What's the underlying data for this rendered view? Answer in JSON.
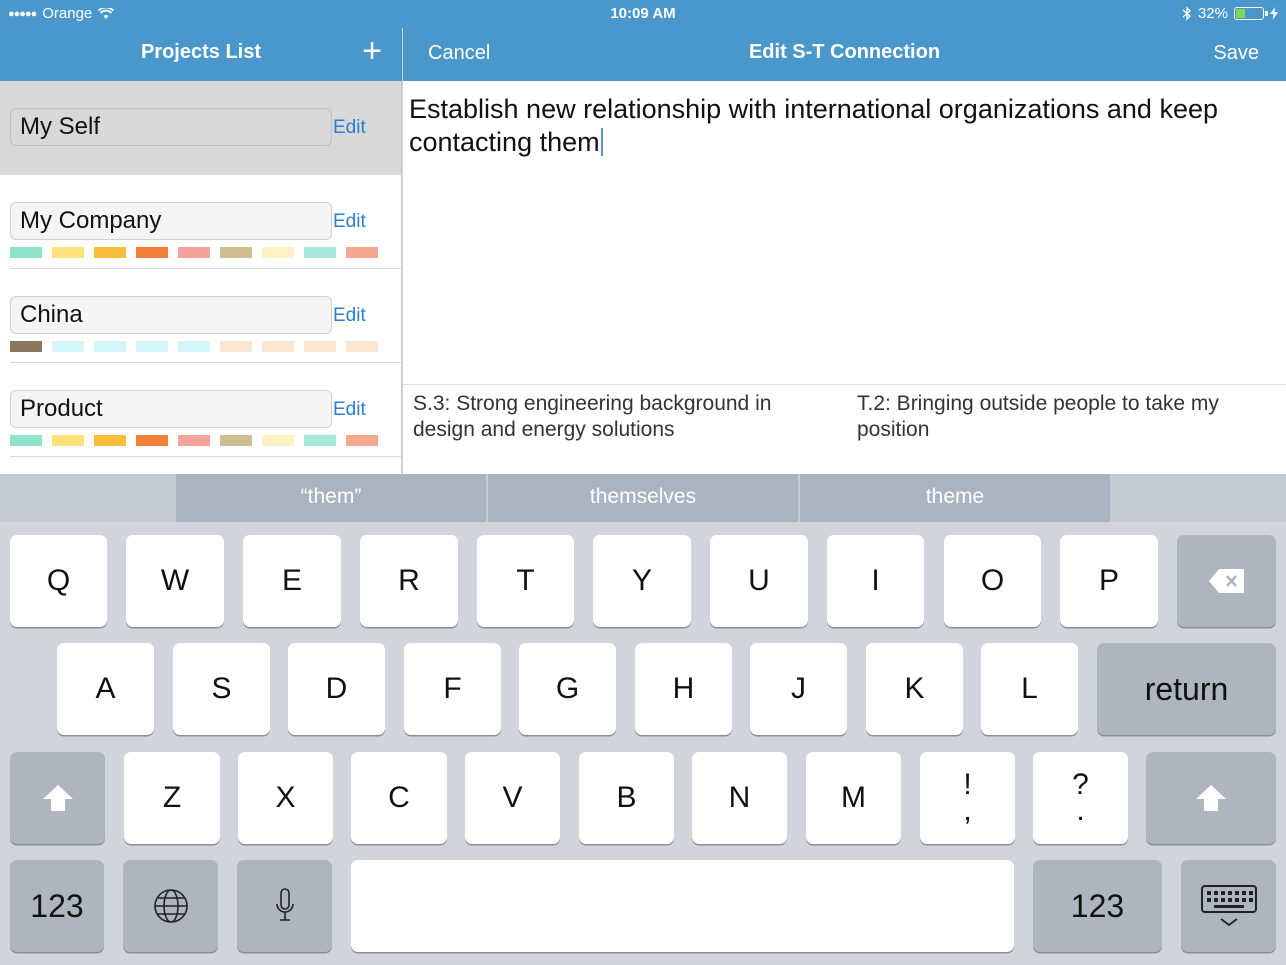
{
  "status_bar": {
    "signal": "●●●●●",
    "carrier": "Orange",
    "time": "10:09 AM",
    "battery": "32%",
    "battery_level": 0.32
  },
  "left_pane": {
    "title": "Projects List",
    "add_glyph": "+",
    "projects": [
      {
        "name": "My Self",
        "edit": "Edit",
        "selected": true,
        "swatches": []
      },
      {
        "name": "My Company",
        "edit": "Edit",
        "swatches": [
          "#8fe3c9",
          "#fbe27a",
          "#f7bd3b",
          "#f5803c",
          "#f6a49a",
          "#cdbf92",
          "#fdf2c4",
          "#a8e8d9",
          "#f6a78f"
        ]
      },
      {
        "name": "China",
        "edit": "Edit",
        "swatches": [
          "#8a7560",
          "#d4f6fb",
          "#d4f6fb",
          "#d4f6fb",
          "#d4f6fb",
          "#fbe6d3",
          "#fbe6d3",
          "#fbe6d3",
          "#fbe6d3"
        ]
      },
      {
        "name": "Product",
        "edit": "Edit",
        "swatches": [
          "#8fe3c9",
          "#fbe27a",
          "#f7bd3b",
          "#f5803c",
          "#f6a49a",
          "#cdbf92",
          "#fdf2c4",
          "#a8e8d9",
          "#f6a78f"
        ]
      }
    ]
  },
  "right_pane": {
    "cancel": "Cancel",
    "title": "Edit S-T Connection",
    "save": "Save",
    "editor_text": "Establish new relationship with international organizations and keep contacting them",
    "strength": "S.3: Strong engineering background in design and energy solutions",
    "threat": "T.2: Bringing outside people to take my position"
  },
  "keyboard": {
    "suggestions": [
      "“them”",
      "themselves",
      "theme"
    ],
    "row1": [
      "Q",
      "W",
      "E",
      "R",
      "T",
      "Y",
      "U",
      "I",
      "O",
      "P"
    ],
    "row2": [
      "A",
      "S",
      "D",
      "F",
      "G",
      "H",
      "J",
      "K",
      "L"
    ],
    "row3": [
      "Z",
      "X",
      "C",
      "V",
      "B",
      "N",
      "M"
    ],
    "punct1": {
      "top": "!",
      "bottom": ","
    },
    "punct2": {
      "top": "?",
      "bottom": "."
    },
    "return": "return",
    "numbers": "123",
    "icons": {
      "delete": "delete-icon",
      "shift": "shift-icon",
      "globe": "globe-icon",
      "mic": "microphone-icon",
      "hide": "keyboard-hide-icon"
    }
  },
  "colors": {
    "nav_bar": "#4a97cc",
    "link": "#2a7fd4",
    "keyboard_bg": "#d1d5db",
    "key": "#ffffff",
    "key_dark": "#aeb5bf"
  }
}
